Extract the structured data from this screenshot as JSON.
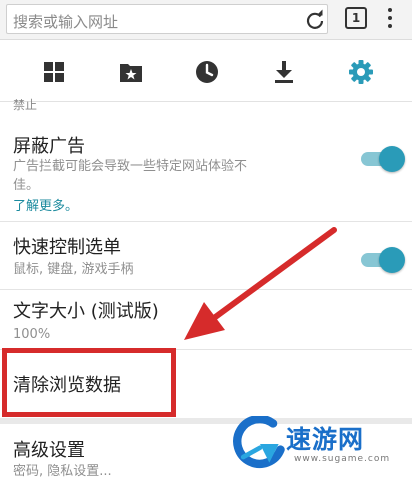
{
  "toolbar": {
    "search_placeholder": "搜索或输入网址",
    "tab_count": "1"
  },
  "icons": [
    "bookmarks-grid-icon",
    "saved-pages-icon",
    "history-icon",
    "downloads-icon",
    "settings-icon"
  ],
  "settings": {
    "partial_top_text": "禁止",
    "ad_block": {
      "title": "屏蔽广告",
      "desc_line1": "广告拦截可能会导致一些特定网站体验不",
      "desc_line2": "佳。",
      "link": "了解更多。",
      "enabled": true
    },
    "speed_menu": {
      "title": "快速控制选单",
      "desc": "鼠标, 键盘, 游戏手柄",
      "enabled": true
    },
    "text_size": {
      "title": "文字大小 (测试版)",
      "value": "100%"
    },
    "clear_data": {
      "title": "清除浏览数据"
    },
    "advanced": {
      "title": "高级设置",
      "desc": "密码, 隐私设置..."
    }
  },
  "watermark": {
    "brand": "速游网",
    "url": "www.sugame.com"
  },
  "colors": {
    "accent": "#2a9bb8",
    "toggle_track": "#87c6d4",
    "highlight": "#d62b2b",
    "link": "#1b8a9e",
    "watermark": "#1a6fc9"
  }
}
